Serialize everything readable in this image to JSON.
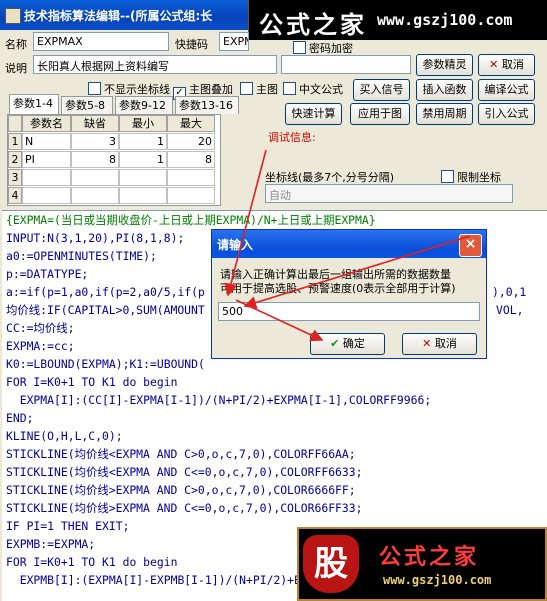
{
  "window": {
    "title": "技术指标算法编辑--(所属公式组:长"
  },
  "watermark_top": {
    "name": "公式之家",
    "url": "www.gszj100.com"
  },
  "watermark_bottom": {
    "mark": "股",
    "name": "公式之家",
    "url": "www.gszj100.com"
  },
  "form": {
    "name_label": "名称",
    "name_value": "EXPMAX",
    "code_label": "快捷码",
    "code_value": "EXPM",
    "password_label": "密码加密",
    "desc_label": "说明",
    "desc_value": "长阳真人根据网上资料编写"
  },
  "options": {
    "hide_axis": "不显示坐标线",
    "main_overlay": "主图叠加",
    "main": "主图",
    "chinese": "中文公式"
  },
  "buttons": {
    "param_tune": "参数精灵",
    "cancel": "取消",
    "import_signal": "买入信号",
    "insert_func": "插入函数",
    "compile": "编译公式",
    "quick_calc": "快速计算",
    "apply_chart": "应用于图",
    "disable_period": "禁用周期",
    "import_formula": "引入公式"
  },
  "param_tabs": [
    "参数1-4",
    "参数5-8",
    "参数9-12",
    "参数13-16"
  ],
  "param_table": {
    "headers": [
      "参数名",
      "缺省",
      "最小",
      "最大"
    ],
    "rows": [
      {
        "idx": "1",
        "name": "N",
        "def": "3",
        "min": "1",
        "max": "20"
      },
      {
        "idx": "2",
        "name": "PI",
        "def": "8",
        "min": "1",
        "max": "8"
      },
      {
        "idx": "3",
        "name": "",
        "def": "",
        "min": "",
        "max": ""
      },
      {
        "idx": "4",
        "name": "",
        "def": "",
        "min": "",
        "max": ""
      }
    ]
  },
  "debug": {
    "label": "调试信息:"
  },
  "axis": {
    "label": "坐标线(最多7个,分号分隔)",
    "limit_label": "限制坐标",
    "auto_value": "自动"
  },
  "code_lines": [
    "{EXPMA=(当日或当期收盘价-上日或上期EXPMA)/N+上日或上期EXPMA}",
    "INPUT:N(3,1,20),PI(8,1,8);",
    "a0:=OPENMINUTES(TIME);",
    "p:=DATATYPE;",
    "a:=if(p=1,a0,if(p=2,a0/5,if(p",
    "均价线:IF(CAPITAL>0,SUM(AMOUNT",
    "CC:=均价线;",
    "EXPMA:=cc;",
    "K0:=LBOUND(EXPMA);K1:=UBOUND(",
    "FOR I=K0+1 TO K1 do begin",
    "  EXPMA[I]:(CC[I]-EXPMA[I-1])/(N+PI/2)+EXPMA[I-1],COLORFF9966;",
    "END;",
    "KLINE(O,H,L,C,0);",
    "STICKLINE(均价线<EXPMA AND C>0,o,c,7,0),COLORFF66AA;",
    "STICKLINE(均价线<EXPMA AND C<=0,o,c,7,0),COLORFF6633;",
    "STICKLINE(均价线>EXPMA AND C>0,o,c,7,0),COLOR6666FF;",
    "STICKLINE(均价线>EXPMA AND C<=0,o,c,7,0),COLOR66FF33;",
    "IF PI=1 THEN EXIT;",
    "EXPMB:=EXPMA;",
    "FOR I=K0+1 TO K1 do begin",
    "  EXPMB[I]:(EXPMA[I]-EXPMB[I-1])/(N+PI/2)+E"
  ],
  "code_overflow": {
    "line5_tail": "),0,1",
    "line6_tail": "VOL,"
  },
  "dialog": {
    "title": "请输入",
    "close": "×",
    "message_line1": "请输入正确计算出最后一组输出所需的数据数量",
    "message_line2": "可用于提高选股、预警速度(0表示全部用于计算)",
    "value": "500",
    "ok": "确定",
    "cancel": "取消"
  },
  "colors": {
    "arrow": "#e02020",
    "comment": "#008000",
    "keyword": "#0000a0",
    "titlebar": "#0a4fc8"
  }
}
